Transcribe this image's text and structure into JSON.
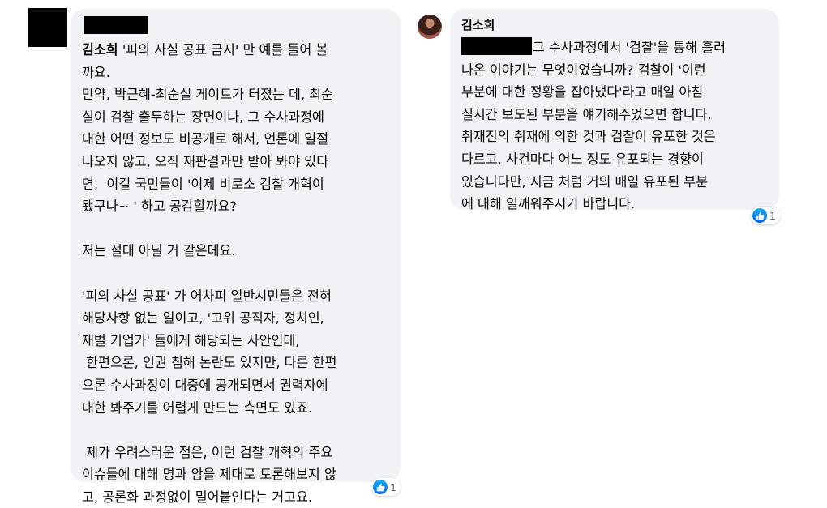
{
  "comments": [
    {
      "author": "",
      "text_first_line_name": "김소희",
      "text": " '피의 사실 공표 금지' 만 예를 들어 볼\n까요.\n만약, 박근혜-최순실 게이트가 터졌는 데, 최순\n실이 검찰 출두하는 장면이나, 그 수사과정에\n대한 어떤 정보도 비공개로 해서, 언론에 일절\n나오지 않고, 오직 재판결과만 받아 봐야 있다\n면,  이걸 국민들이 '이제 비로소 검찰 개혁이\n됐구나~ ' 하고 공감할까요?\n\n저는 절대 아닐 거 같은데요.\n\n'피의 사실 공표' 가 어차피 일반시민들은 전혀\n해당사항 없는 일이고, '고위 공직자, 정치인,\n재벌 기업가' 들에게 해당되는 사안인데,\n 한편으론, 인권 침해 논란도 있지만, 다른 한편\n으론 수사과정이 대중에 공개되면서 권력자에\n대한 봐주기를 어렵게 만드는 측면도 있죠.\n\n 제가 우려스러운 점은, 이런 검찰 개혁의 주요\n이슈들에 대해 명과 암을 제대로 토론해보지 않\n고, 공론화 과정없이 밀어붙인다는 거고요.",
      "reactions": {
        "count": "1",
        "icon": "like-icon"
      }
    },
    {
      "author": "김소희",
      "text": "그 수사과정에서 '검찰'을 통해 흘러\n나온 이야기는 무엇이었습니까? 검찰이 '이런\n부분에 대한 정황을 잡아냈다'라고 매일 아침\n실시간 보도된 부분을 얘기해주었으면 합니다.\n취재진의 취재에 의한 것과 검찰이 유포한 것은\n다르고, 사건마다 어느 정도 유포되는 경향이\n있습니다만, 지금 처럼 거의 매일 유포된 부분\n에 대해 일깨워주시기 바랍니다.",
      "reactions": {
        "count": "1",
        "icon": "like-icon"
      }
    }
  ],
  "colors": {
    "bubble": "#f0f2f5",
    "redaction": "#000000",
    "like_blue": "#1877f2"
  }
}
